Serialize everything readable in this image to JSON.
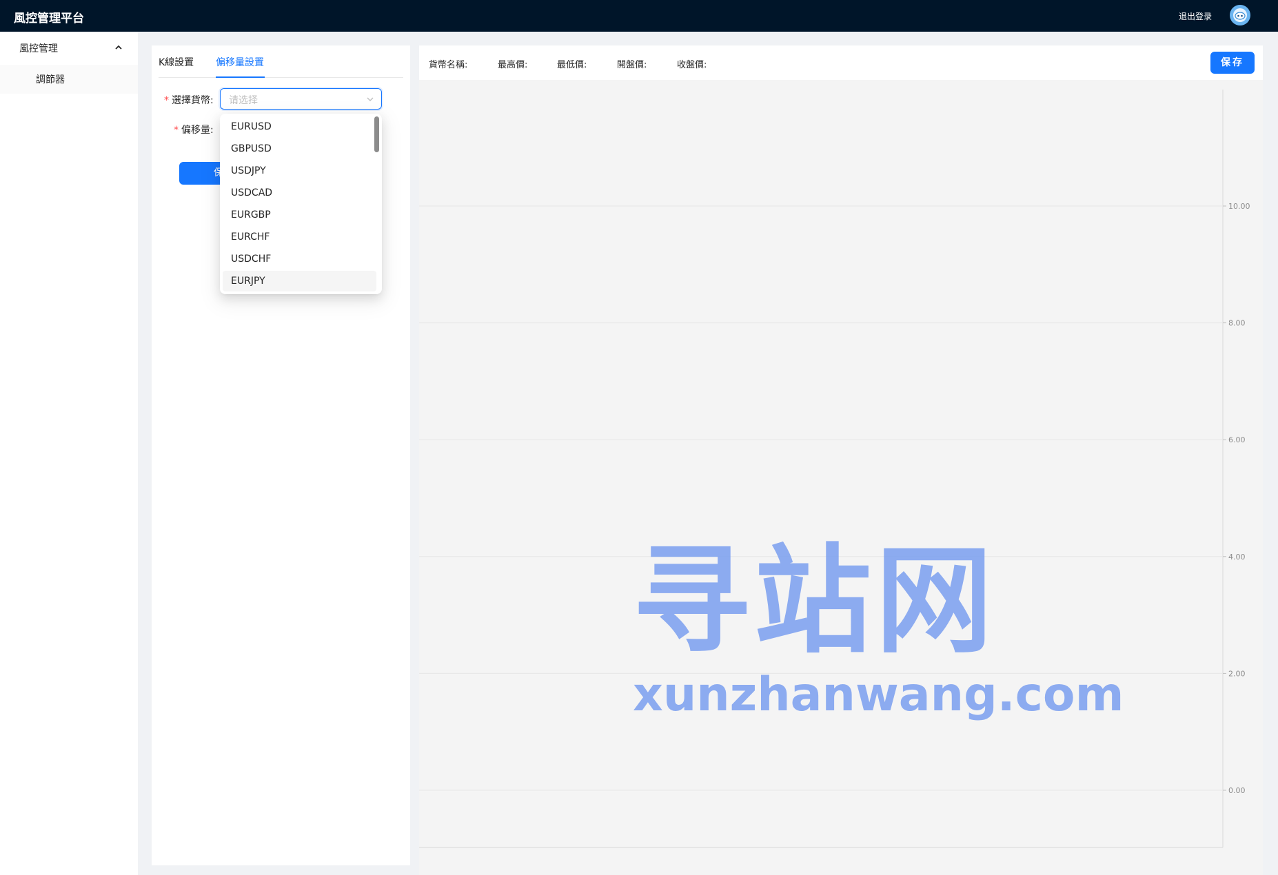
{
  "app": {
    "title": "風控管理平台",
    "logout_label": "退出登录"
  },
  "sidebar": {
    "group_label": "風控管理",
    "items": [
      {
        "label": "調節器"
      }
    ]
  },
  "tabs": [
    {
      "label": "K線設置"
    },
    {
      "label": "偏移量設置"
    }
  ],
  "form": {
    "currency_label": "選擇貨幣:",
    "currency_placeholder": "请选择",
    "offset_label": "偏移量:",
    "save_label": "保"
  },
  "dropdown": {
    "options": [
      "EURUSD",
      "GBPUSD",
      "USDJPY",
      "USDCAD",
      "EURGBP",
      "EURCHF",
      "USDCHF",
      "EURJPY"
    ],
    "active_option": "EURJPY"
  },
  "header_fields": {
    "currency_name": "貨幣名稱:",
    "high": "最高價:",
    "low": "最低價:",
    "open": "開盤價:",
    "close": "收盤價:"
  },
  "save_button": "保存",
  "watermark": {
    "main": "寻站网",
    "sub": "xunzhanwang.com"
  },
  "chart_data": {
    "type": "bar",
    "title": "",
    "xlabel": "",
    "ylabel": "",
    "ylim": [
      0,
      10
    ],
    "yticks": [
      "10.00",
      "8.00",
      "6.00",
      "4.00",
      "2.00",
      "0.00"
    ],
    "series": []
  },
  "colors": {
    "primary": "#1677ff",
    "topbar": "#001529",
    "chart_bg": "#f4f4f4"
  }
}
